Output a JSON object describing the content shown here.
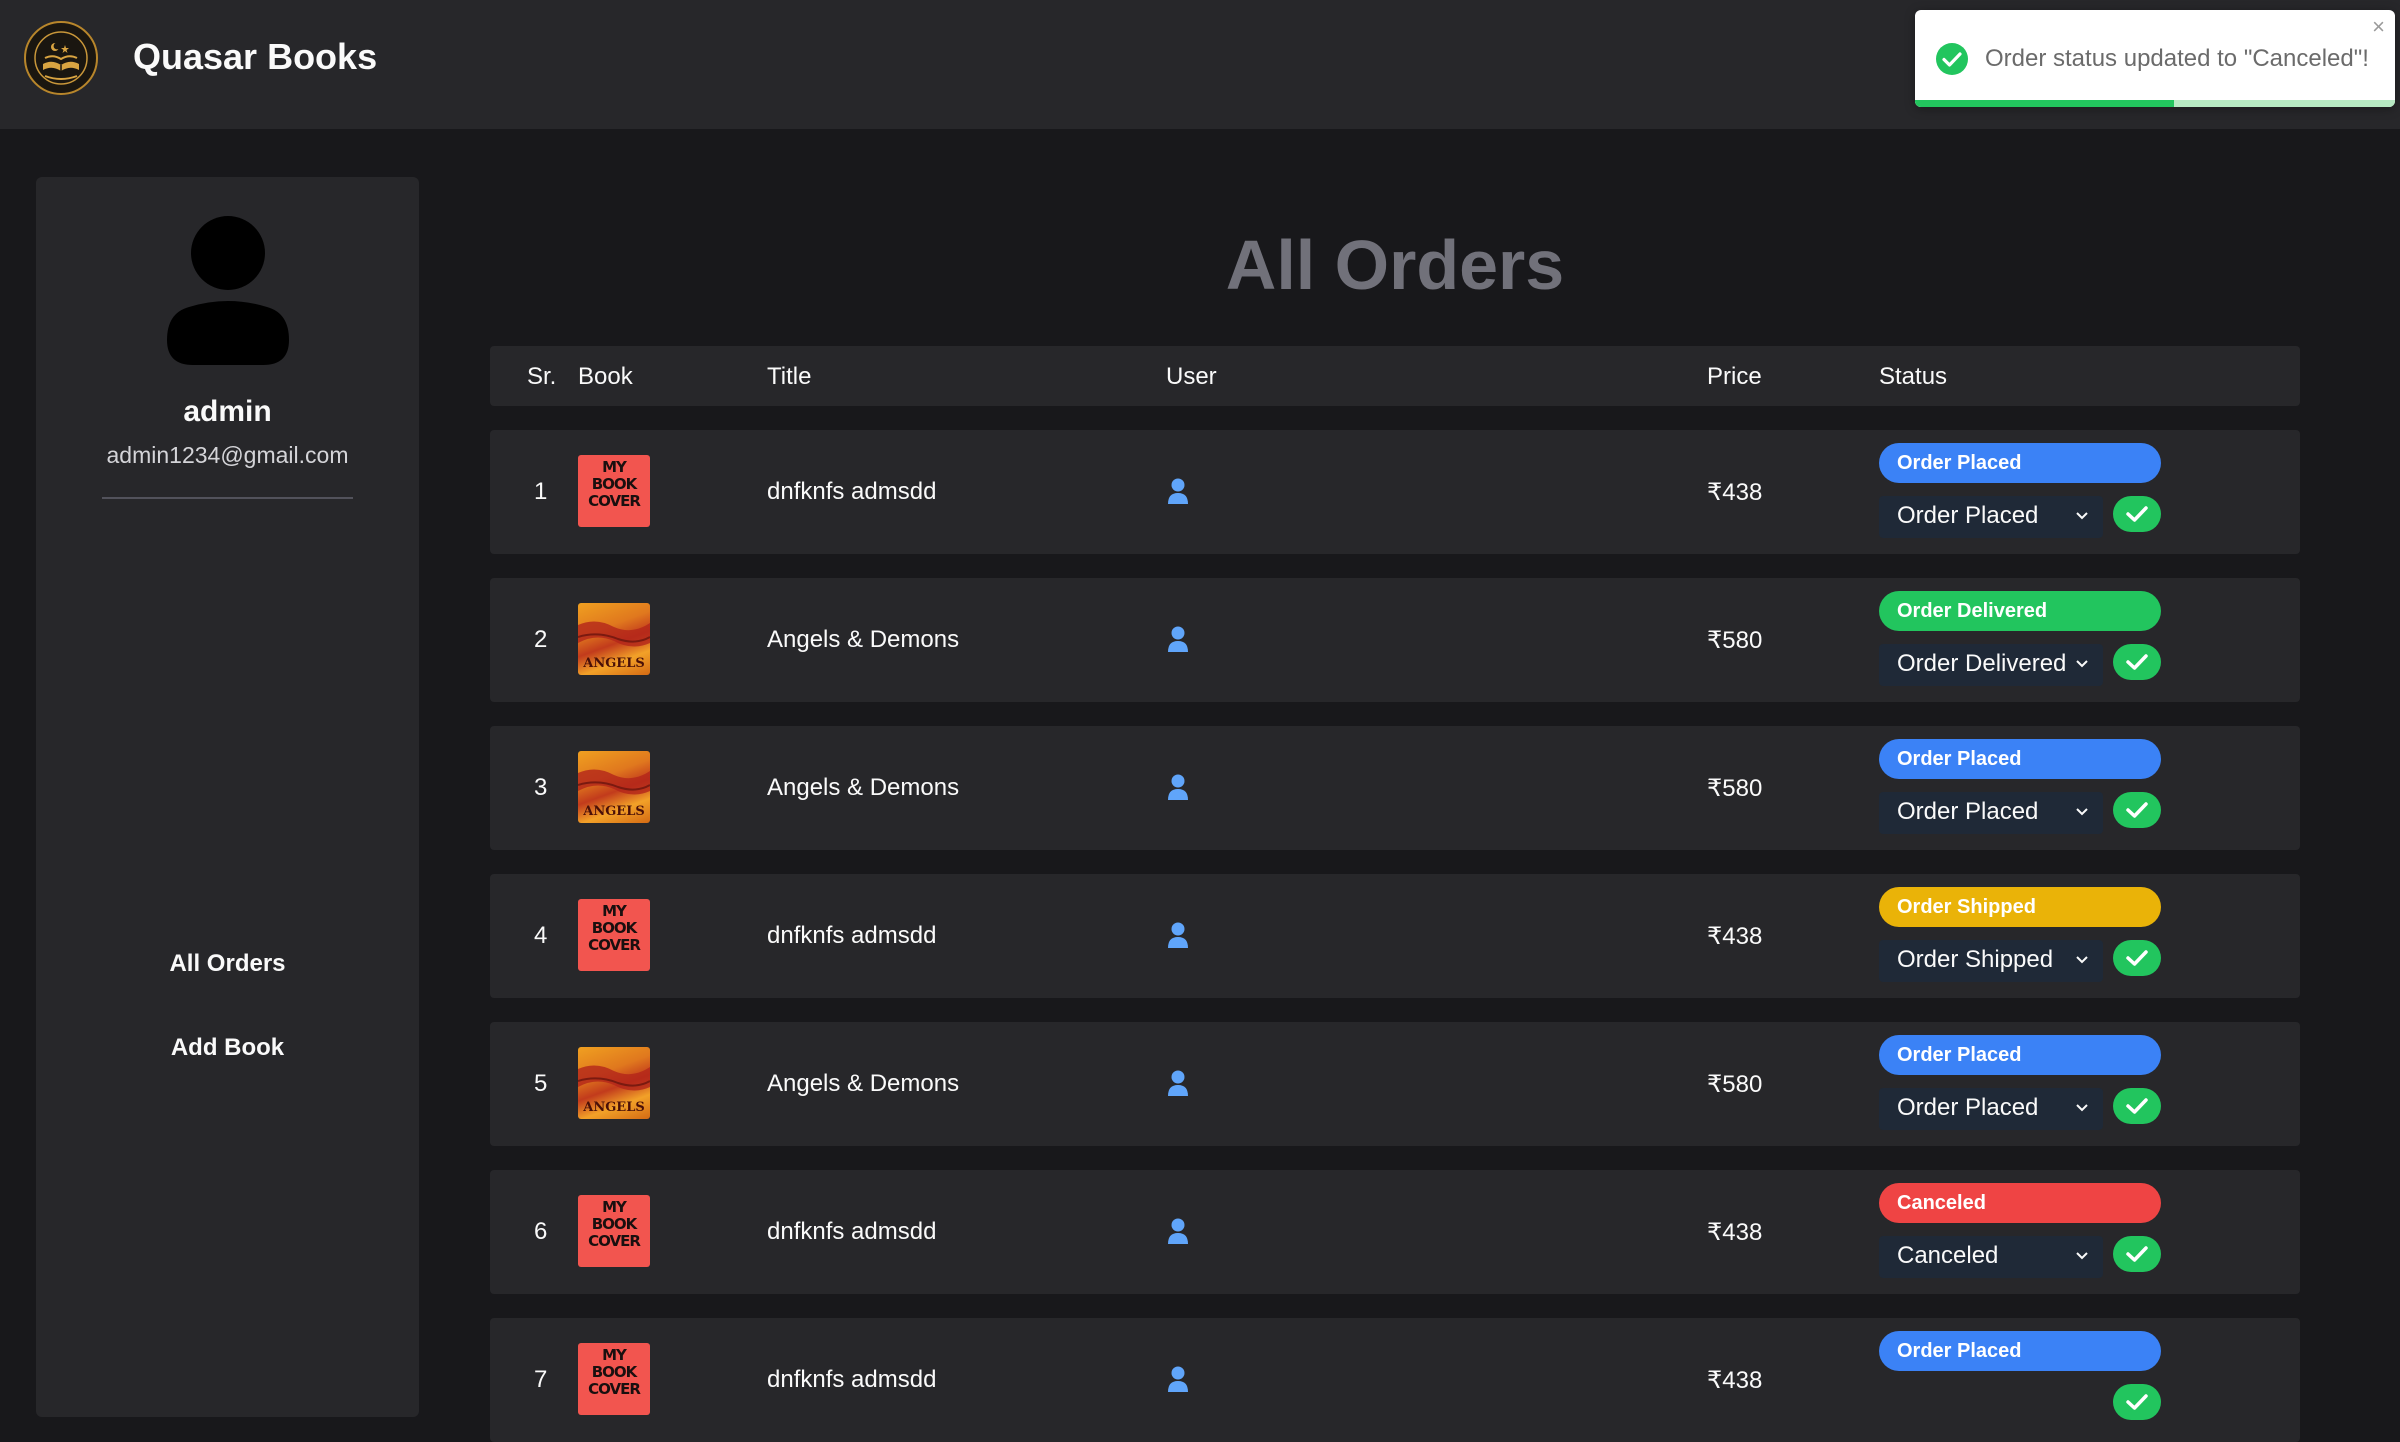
{
  "navbar": {
    "brand": "Quasar Books"
  },
  "toast": {
    "message": "Order status updated to \"Canceled\"!",
    "close": "×",
    "progress_percent": 54,
    "accent": "#22c55e"
  },
  "sidebar": {
    "name": "admin",
    "email": "admin1234@gmail.com",
    "links": [
      "All Orders",
      "Add Book"
    ]
  },
  "page": {
    "title": "All Orders"
  },
  "table": {
    "headers": [
      "Sr.",
      "Book",
      "Title",
      "User",
      "Price",
      "Status"
    ],
    "rows": [
      {
        "sr": "1",
        "cover": "my-book-cover",
        "title": "dnfknfs admsdd",
        "price": "₹438",
        "badge": "Order Placed",
        "badge_color": "#3b82f6",
        "select": "Order Placed"
      },
      {
        "sr": "2",
        "cover": "angels",
        "title": "Angels & Demons",
        "price": "₹580",
        "badge": "Order Delivered",
        "badge_color": "#22c55e",
        "select": "Order Delivered"
      },
      {
        "sr": "3",
        "cover": "angels",
        "title": "Angels & Demons",
        "price": "₹580",
        "badge": "Order Placed",
        "badge_color": "#3b82f6",
        "select": "Order Placed"
      },
      {
        "sr": "4",
        "cover": "my-book-cover",
        "title": "dnfknfs admsdd",
        "price": "₹438",
        "badge": "Order Shipped",
        "badge_color": "#eab308",
        "select": "Order Shipped"
      },
      {
        "sr": "5",
        "cover": "angels",
        "title": "Angels & Demons",
        "price": "₹580",
        "badge": "Order Placed",
        "badge_color": "#3b82f6",
        "select": "Order Placed"
      },
      {
        "sr": "6",
        "cover": "my-book-cover",
        "title": "dnfknfs admsdd",
        "price": "₹438",
        "badge": "Canceled",
        "badge_color": "#ef4444",
        "select": "Canceled"
      },
      {
        "sr": "7",
        "cover": "my-book-cover",
        "title": "dnfknfs admsdd",
        "price": "₹438",
        "badge": "Order Placed",
        "badge_color": "#3b82f6",
        "select": ""
      }
    ]
  },
  "cover_text": {
    "my_book_cover": [
      "MY",
      "BOOK",
      "COVER"
    ],
    "angels": "ANGELS"
  },
  "icons": {
    "user": "user-icon",
    "confirm": "check-icon",
    "toast": "check-circle-icon"
  }
}
